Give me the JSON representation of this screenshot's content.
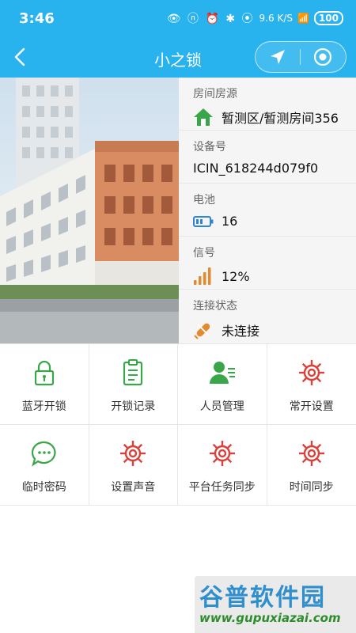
{
  "status_bar": {
    "time": "3:46",
    "net_speed": "9.6 K/S",
    "battery": "100"
  },
  "app_bar": {
    "title": "小之锁"
  },
  "info": {
    "room_label": "房间房源",
    "room_value": "暂测区/暂测房间356",
    "device_label": "设备号",
    "device_value": "ICIN_618244d079f0",
    "battery_label": "电池",
    "battery_value": "16",
    "signal_label": "信号",
    "signal_value": "12%",
    "conn_label": "连接状态",
    "conn_value": "未连接"
  },
  "grid": {
    "items": [
      {
        "label": "蓝牙开锁",
        "icon": "lock-icon",
        "color": "#3aa64a"
      },
      {
        "label": "开锁记录",
        "icon": "clipboard-icon",
        "color": "#3aa64a"
      },
      {
        "label": "人员管理",
        "icon": "user-manage-icon",
        "color": "#3aa64a"
      },
      {
        "label": "常开设置",
        "icon": "gear-icon",
        "color": "#d9413a"
      },
      {
        "label": "临时密码",
        "icon": "chat-icon",
        "color": "#3aa64a"
      },
      {
        "label": "设置声音",
        "icon": "gear-icon",
        "color": "#d9413a"
      },
      {
        "label": "平台任务同步",
        "icon": "gear-icon",
        "color": "#d9413a"
      },
      {
        "label": "时间同步",
        "icon": "gear-icon",
        "color": "#d9413a"
      }
    ]
  },
  "watermark": {
    "title": "谷普软件园",
    "url": "www.gupuxiazai.com"
  },
  "colors": {
    "brand": "#29b3ee",
    "green": "#3aa64a",
    "red": "#d9413a"
  }
}
